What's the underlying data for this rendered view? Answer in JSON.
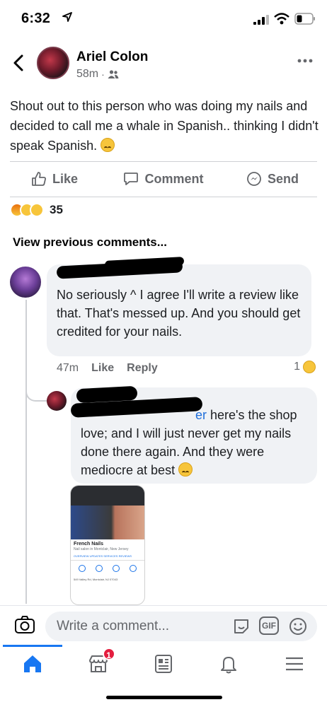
{
  "status_bar": {
    "time": "6:32"
  },
  "post": {
    "author": "Ariel Colon",
    "timestamp": "58m",
    "text": "Shout out to this person who was doing my nails and decided to call me a whale in Spanish.. thinking I didn't speak Spanish.",
    "reaction_count": "35"
  },
  "actions": {
    "like": "Like",
    "comment": "Comment",
    "send": "Send"
  },
  "view_previous": "View previous comments...",
  "comment1": {
    "text": "No seriously ^ I agree I'll write a review like that. That's messed up. And you should get credited for your nails.",
    "time": "47m",
    "like": "Like",
    "reply": "Reply",
    "reaction_count": "1"
  },
  "reply1": {
    "mention_tail": "er",
    "text": " here's the shop love; and I will just never get my nails done there again. And they were mediocre at best"
  },
  "shared_screenshot": {
    "business_name": "French Nails",
    "subtitle": "Nail salon in Montclair, New Jersey",
    "tabs": "OVERVIEW  UPDATES  SERVICES  REVIEWS",
    "address": "549 Valley Rd, Montclair, NJ 07043"
  },
  "composer": {
    "placeholder": "Write a comment...",
    "gif": "GIF"
  },
  "nav": {
    "marketplace_badge": "1"
  },
  "colors": {
    "accent": "#1877f2",
    "badge": "#e41e3f",
    "text_secondary": "#65676b"
  }
}
